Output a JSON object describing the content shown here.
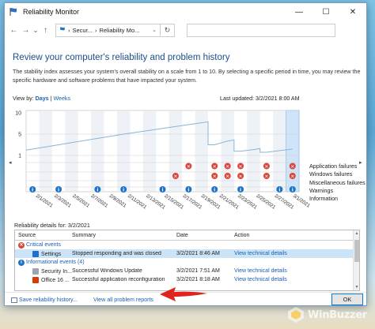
{
  "window": {
    "title": "Reliability Monitor",
    "minimize": "—",
    "maximize": "☐",
    "close": "✕"
  },
  "addressbar": {
    "back": "←",
    "forward": "→",
    "dropdown": "⌄",
    "up": "↑",
    "crumbs": [
      "Secur...",
      "Reliability Mo..."
    ],
    "chevron": "›",
    "refresh": "↻"
  },
  "page": {
    "heading": "Review your computer's reliability and problem history",
    "description": "The stability index assesses your system's overall stability on a scale from 1 to 10. By selecting a specific period in time, you may review the specific hardware and software problems that have impacted your system.",
    "viewby_label": "View by:",
    "viewby_days": "Days",
    "viewby_sep": "|",
    "viewby_weeks": "Weeks",
    "last_updated": "Last updated: 3/2/2021 8:00 AM"
  },
  "chart_data": {
    "type": "line",
    "y_ticks": [
      "10",
      "5",
      "1"
    ],
    "ylim": [
      1,
      10
    ],
    "x_labels": [
      "2/1/2021",
      "2/3/2021",
      "2/5/2021",
      "2/7/2021",
      "2/9/2021",
      "2/11/2021",
      "2/13/2021",
      "2/15/2021",
      "2/17/2021",
      "2/19/2021",
      "2/21/2021",
      "2/23/2021",
      "2/25/2021",
      "2/27/2021",
      "3/1/2021"
    ],
    "columns": 21,
    "selected_column": 20,
    "stability_index": [
      2.2,
      2.6,
      3.0,
      3.4,
      3.8,
      4.2,
      4.6,
      5.0,
      5.4,
      5.8,
      6.2,
      6.6,
      7.0,
      7.4,
      3.0,
      3.7,
      1.8,
      2.1,
      1.6,
      1.9,
      2.2
    ],
    "stability_index_drops_after": [
      13,
      15,
      17
    ],
    "row_labels": [
      "Application failures",
      "Windows failures",
      "Miscellaneous failures",
      "Warnings",
      "Information"
    ],
    "application_failures": [
      0,
      0,
      0,
      0,
      0,
      0,
      0,
      0,
      0,
      0,
      0,
      0,
      1,
      0,
      1,
      1,
      1,
      0,
      1,
      0,
      1
    ],
    "windows_failures": [
      0,
      0,
      0,
      0,
      0,
      0,
      0,
      0,
      0,
      0,
      0,
      1,
      0,
      0,
      1,
      1,
      1,
      0,
      1,
      0,
      1
    ],
    "information": [
      1,
      0,
      1,
      0,
      0,
      1,
      0,
      1,
      0,
      0,
      1,
      0,
      1,
      0,
      1,
      0,
      1,
      0,
      0,
      1,
      1
    ],
    "colors": {
      "failure": "#d9463b",
      "information": "#1e72c8",
      "selected": "#cfe4f8",
      "line": "#8ab4d6"
    }
  },
  "details": {
    "label": "Reliability details for: 3/2/2021",
    "columns": [
      "Source",
      "Summary",
      "Date",
      "Action"
    ],
    "critical_header": "Critical events",
    "critical": [
      {
        "source": "Settings",
        "summary": "Stopped responding and was closed",
        "date": "3/2/2021 8:46 AM",
        "action": "View technical details"
      }
    ],
    "info_header": "Informational events (4)",
    "info": [
      {
        "source": "Security In...",
        "summary": "Successful Windows Update",
        "date": "3/2/2021 7:51 AM",
        "action": "View technical details"
      },
      {
        "source": "Office 16 ...",
        "summary": "Successful application reconfiguration",
        "date": "3/2/2021 8:18 AM",
        "action": "View technical details"
      }
    ]
  },
  "footer": {
    "save_history": "Save reliability history...",
    "view_all": "View all problem reports",
    "ok": "OK"
  },
  "watermark": {
    "text": "WinBuzzer"
  }
}
